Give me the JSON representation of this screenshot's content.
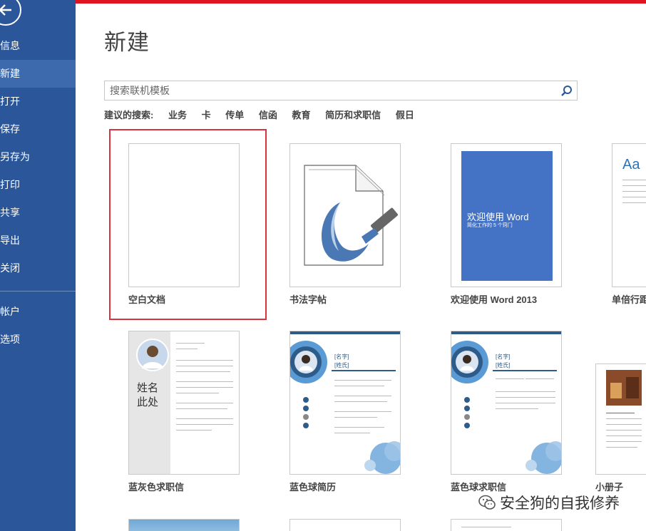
{
  "sidebar": {
    "items": [
      {
        "label": "信息"
      },
      {
        "label": "新建"
      },
      {
        "label": "打开"
      },
      {
        "label": "保存"
      },
      {
        "label": "另存为"
      },
      {
        "label": "打印"
      },
      {
        "label": "共享"
      },
      {
        "label": "导出"
      },
      {
        "label": "关闭"
      },
      {
        "label": "帐户"
      },
      {
        "label": "选项"
      }
    ],
    "active": "新建"
  },
  "header": {
    "title": "新建"
  },
  "search": {
    "placeholder": "搜索联机模板"
  },
  "suggested": {
    "label": "建议的搜索:",
    "links": [
      "业务",
      "卡",
      "传单",
      "信函",
      "教育",
      "简历和求职信",
      "假日"
    ]
  },
  "templates": {
    "blank": "空白文档",
    "calligraphy": "书法字帖",
    "welcome": "欢迎使用 Word 2013",
    "single": "单倍行距",
    "resume_gray": "蓝灰色求职信",
    "resume_blue": "蓝色球简历",
    "cover_blue": "蓝色球求职信",
    "booklet": "小册子"
  },
  "welcome_thumb": {
    "line1": "欢迎使用 Word",
    "line2": "简化工作的 5 个窍门"
  },
  "single_thumb": {
    "aa": "Aa"
  },
  "gray_resume_thumb": {
    "name1": "姓名",
    "name2": "此处"
  },
  "blue_resume_thumb": {
    "name1": "[名字]",
    "name2": "[姓氏]"
  },
  "watermark": {
    "text": "安全狗的自我修养"
  },
  "colors": {
    "sidebar": "#2b579a",
    "active": "#3d6aad",
    "accent_red": "#e0141e",
    "word_blue": "#4472c4"
  }
}
